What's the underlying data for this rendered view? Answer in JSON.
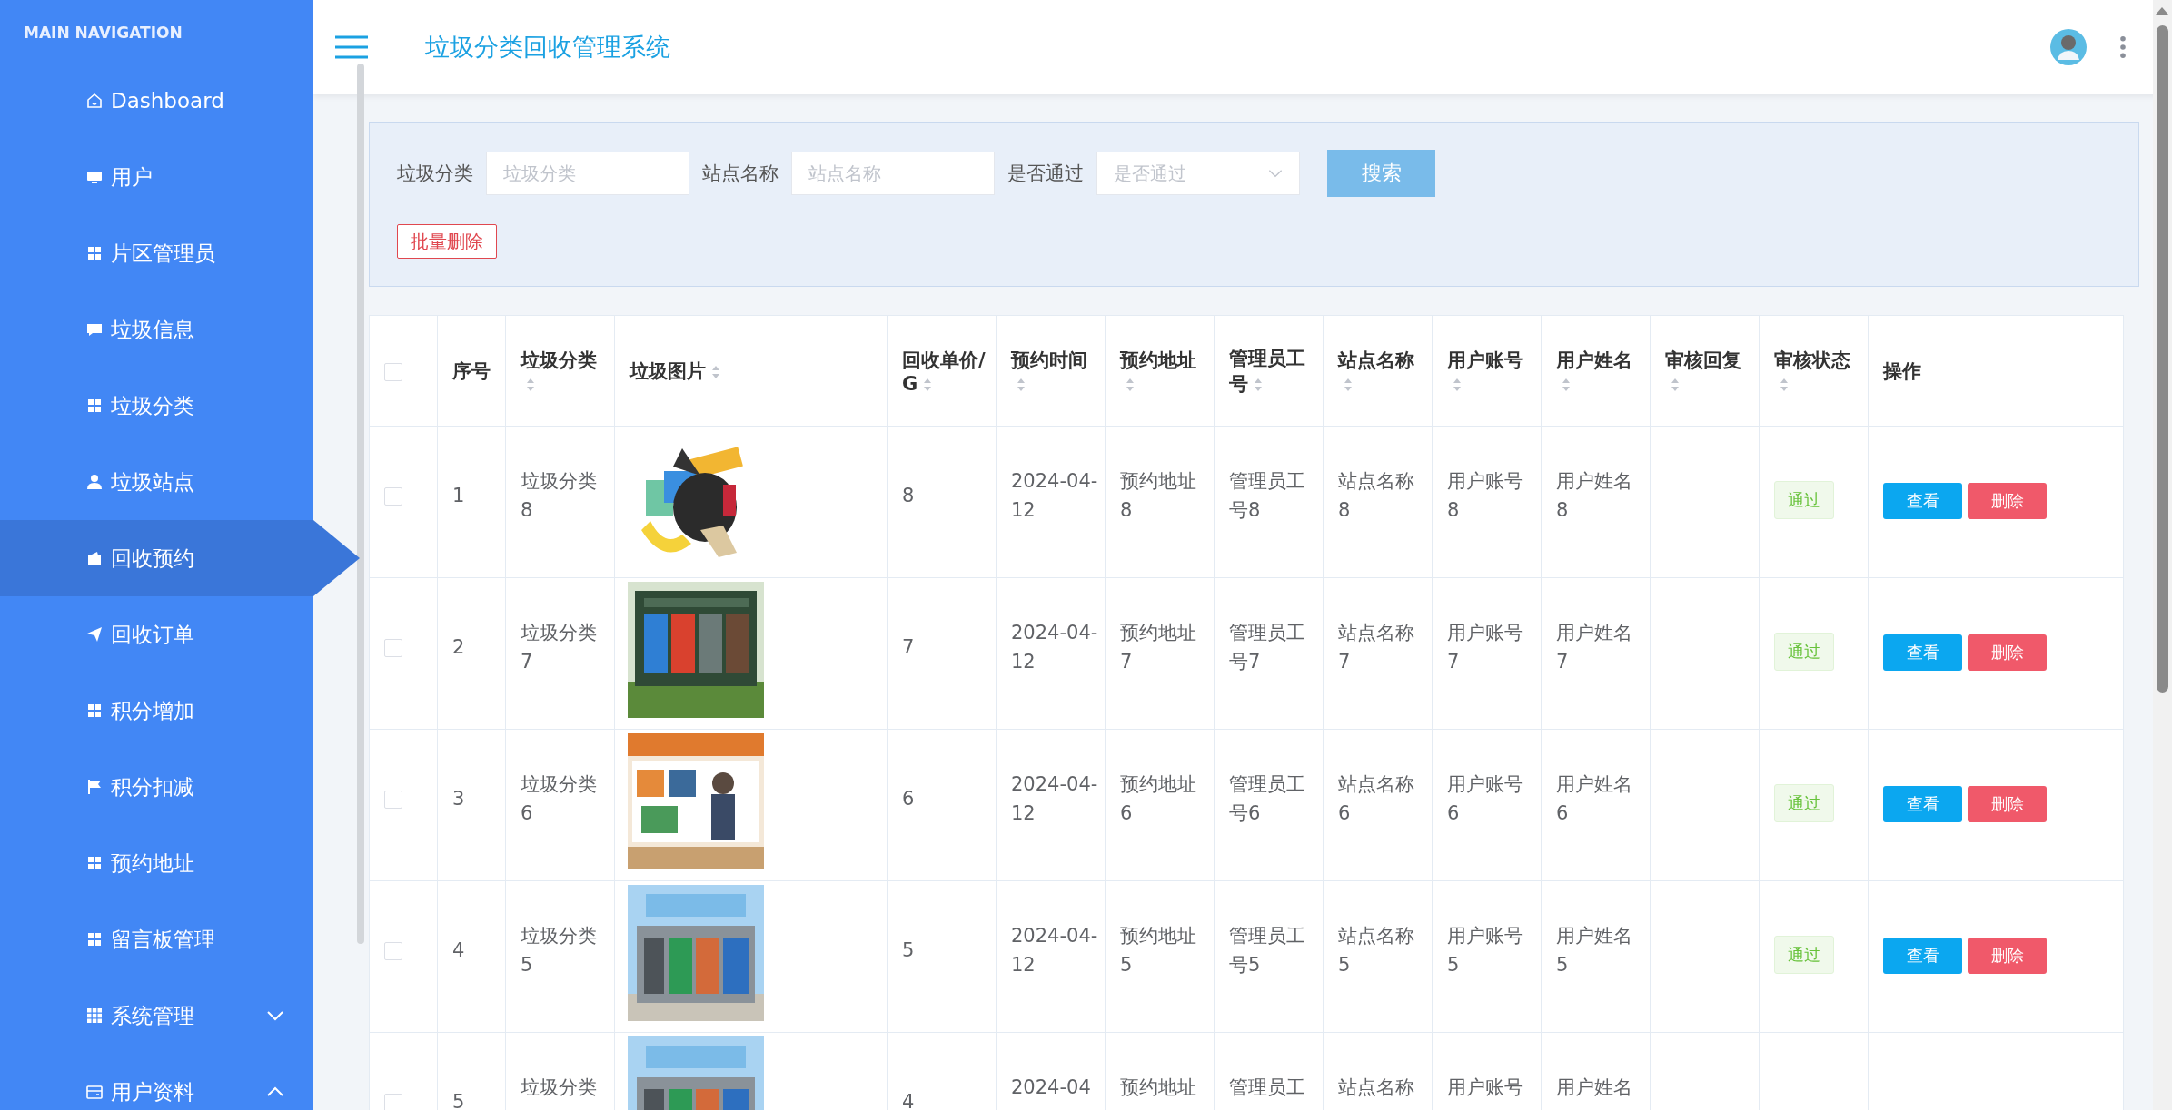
{
  "sidebar": {
    "heading": "MAIN NAVIGATION",
    "items": [
      {
        "label": "Dashboard",
        "selected": false
      },
      {
        "label": "用户",
        "selected": false
      },
      {
        "label": "片区管理员",
        "selected": false
      },
      {
        "label": "垃圾信息",
        "selected": false
      },
      {
        "label": "垃圾分类",
        "selected": false
      },
      {
        "label": "垃圾站点",
        "selected": false
      },
      {
        "label": "回收预约",
        "selected": true
      },
      {
        "label": "回收订单",
        "selected": false
      },
      {
        "label": "积分增加",
        "selected": false
      },
      {
        "label": "积分扣减",
        "selected": false
      },
      {
        "label": "预约地址",
        "selected": false
      },
      {
        "label": "留言板管理",
        "selected": false
      },
      {
        "label": "系统管理",
        "selected": false,
        "expanded": false
      },
      {
        "label": "用户资料",
        "selected": false,
        "expanded": true
      }
    ]
  },
  "header": {
    "title": "垃圾分类回收管理系统"
  },
  "search": {
    "fields": [
      {
        "label": "垃圾分类",
        "placeholder": "垃圾分类",
        "kind": "input"
      },
      {
        "label": "站点名称",
        "placeholder": "站点名称",
        "kind": "input"
      },
      {
        "label": "是否通过",
        "placeholder": "是否通过",
        "kind": "select"
      }
    ],
    "button": "搜索",
    "batch_delete": "批量删除"
  },
  "table": {
    "select_all": {
      "checked": false
    },
    "columns": [
      {
        "label": "序号",
        "sortable": false
      },
      {
        "label": "垃圾分类",
        "sortable": true
      },
      {
        "label": "垃圾图片",
        "sortable": true
      },
      {
        "label": "回收单价/G",
        "sortable": true
      },
      {
        "label": "预约时间",
        "sortable": true
      },
      {
        "label": "预约地址",
        "sortable": true
      },
      {
        "label": "管理员工号",
        "sortable": true
      },
      {
        "label": "站点名称",
        "sortable": true
      },
      {
        "label": "用户账号",
        "sortable": true
      },
      {
        "label": "用户姓名",
        "sortable": true
      },
      {
        "label": "审核回复",
        "sortable": true
      },
      {
        "label": "审核状态",
        "sortable": true
      },
      {
        "label": "操作",
        "sortable": false
      }
    ],
    "rows": [
      {
        "checked": false,
        "index": "1",
        "category": "垃圾分类8",
        "price": "8",
        "time": "2024-04-12",
        "address": "预约地址8",
        "admin_no": "管理员工号8",
        "station": "站点名称8",
        "account": "用户账号8",
        "name": "用户姓名8",
        "status": "通过",
        "actions": [
          "查看",
          "删除"
        ]
      },
      {
        "checked": false,
        "index": "2",
        "category": "垃圾分类7",
        "price": "7",
        "time": "2024-04-12",
        "address": "预约地址7",
        "admin_no": "管理员工号7",
        "station": "站点名称7",
        "account": "用户账号7",
        "name": "用户姓名7",
        "status": "通过",
        "actions": [
          "查看",
          "删除"
        ]
      },
      {
        "checked": false,
        "index": "3",
        "category": "垃圾分类6",
        "price": "6",
        "time": "2024-04-12",
        "address": "预约地址6",
        "admin_no": "管理员工号6",
        "station": "站点名称6",
        "account": "用户账号6",
        "name": "用户姓名6",
        "status": "通过",
        "actions": [
          "查看",
          "删除"
        ]
      },
      {
        "checked": false,
        "index": "4",
        "category": "垃圾分类5",
        "price": "5",
        "time": "2024-04-12",
        "address": "预约地址5",
        "admin_no": "管理员工号5",
        "station": "站点名称5",
        "account": "用户账号5",
        "name": "用户姓名5",
        "status": "通过",
        "actions": [
          "查看",
          "删除"
        ]
      },
      {
        "checked": false,
        "index": "5",
        "category": "垃圾分类",
        "price": "4",
        "time": "2024-04",
        "address": "预约地址",
        "admin_no": "管理员工",
        "station": "站点名称",
        "account": "用户账号",
        "name": "用户姓名"
      }
    ]
  }
}
